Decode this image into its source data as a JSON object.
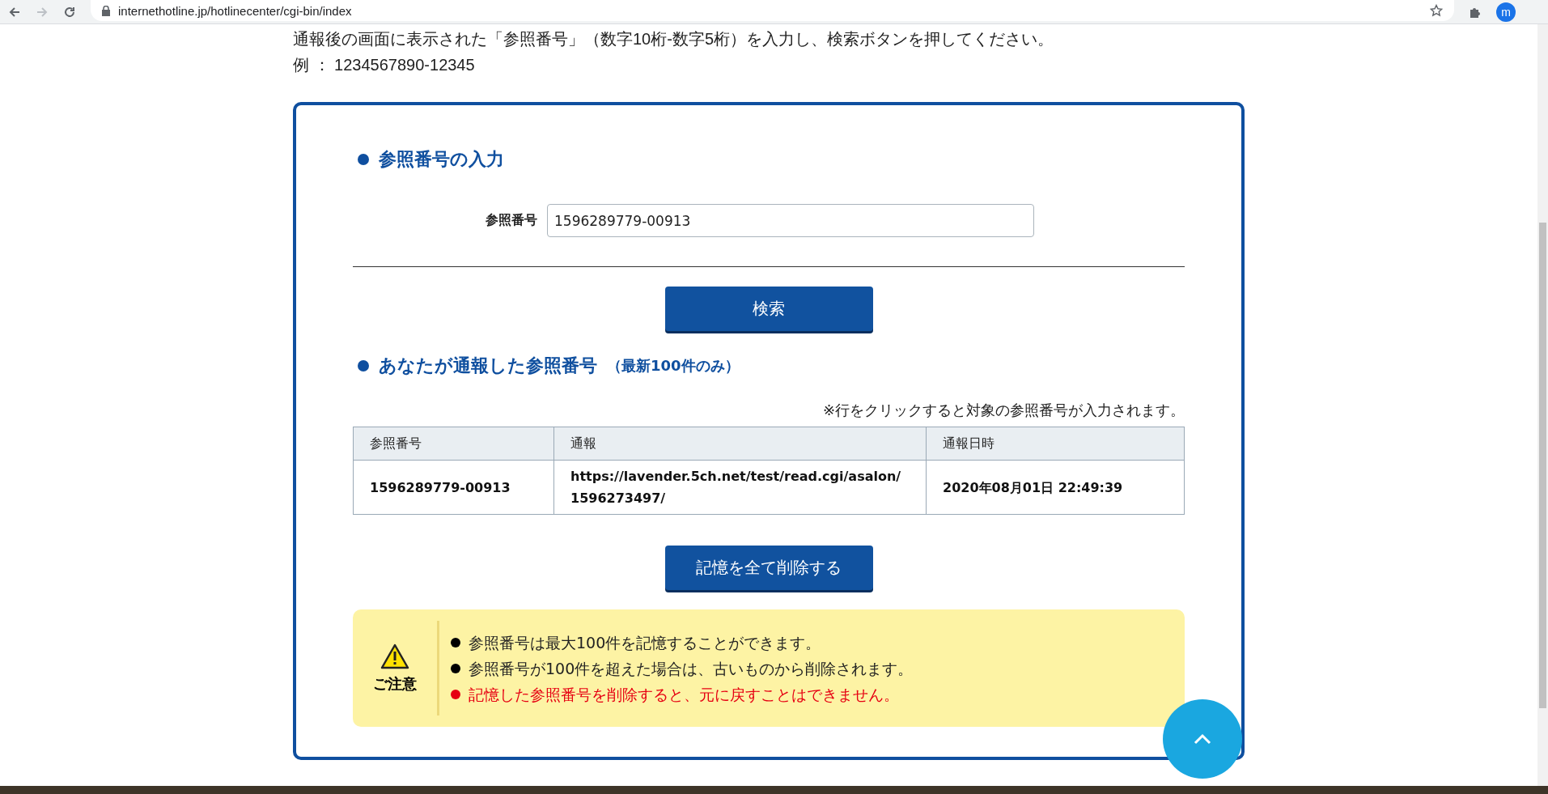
{
  "browser": {
    "url": "internethotline.jp/hotlinecenter/cgi-bin/index",
    "profile_initial": "m"
  },
  "intro": {
    "instruction": "通報後の画面に表示された「参照番号」（数字10桁-数字5桁）を入力し、検索ボタンを押してください。",
    "example": "例 ： 1234567890-12345"
  },
  "input_section": {
    "heading": "参照番号の入力",
    "label": "参照番号",
    "value": "1596289779-00913",
    "button": "検索"
  },
  "history_section": {
    "heading": "あなたが通報した参照番号",
    "heading_note": "（最新100件のみ）",
    "hint": "※行をクリックすると対象の参照番号が入力されます。",
    "table": {
      "columns": [
        "参照番号",
        "通報",
        "通報日時"
      ],
      "rows": [
        [
          "1596289779-00913",
          "https://lavender.5ch.net/test/read.cgi/asalon/1596273497/",
          "2020年08月01日 22:49:39"
        ]
      ]
    },
    "button": "記憶を全て削除する"
  },
  "notice": {
    "label": "ご注意",
    "items": [
      {
        "text": "参照番号は最大100件を記憶することができます。",
        "color": "#000000"
      },
      {
        "text": "参照番号が100件を超えた場合は、古いものから削除されます。",
        "color": "#000000"
      },
      {
        "text": "記憶した参照番号を削除すると、元に戻すことはできません。",
        "color": "#e60012"
      }
    ]
  }
}
